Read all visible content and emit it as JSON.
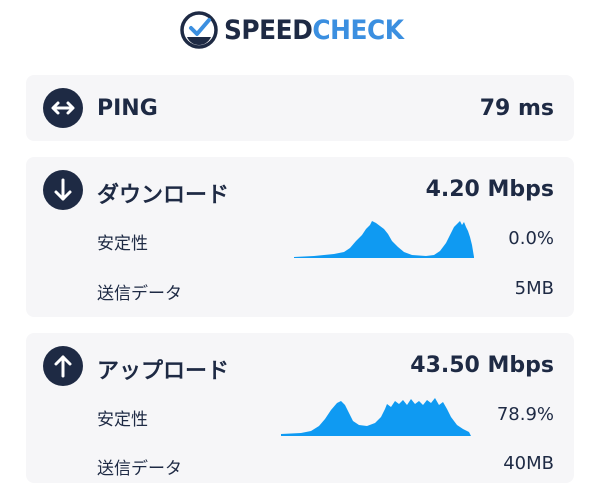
{
  "header": {
    "logo_speed": "SPEED",
    "logo_check": "CHECK",
    "logo_icon": "speedometer-check-icon"
  },
  "colors": {
    "navy": "#1e2a44",
    "brand_blue": "#3b8fe0",
    "graph_blue": "#0f9af2",
    "card_bg": "#f6f6f8"
  },
  "ping": {
    "icon": "ping-arrows-icon",
    "label": "PING",
    "value": "79 ms"
  },
  "download": {
    "icon": "download-arrow-icon",
    "label": "ダウンロード",
    "value": "4.20 Mbps",
    "stability_label": "安定性",
    "stability_value": "0.0%",
    "data_label": "送信データ",
    "data_value": "5MB"
  },
  "upload": {
    "icon": "upload-arrow-icon",
    "label": "アップロード",
    "value": "43.50 Mbps",
    "stability_label": "安定性",
    "stability_value": "78.9%",
    "data_label": "送信データ",
    "data_value": "40MB"
  }
}
